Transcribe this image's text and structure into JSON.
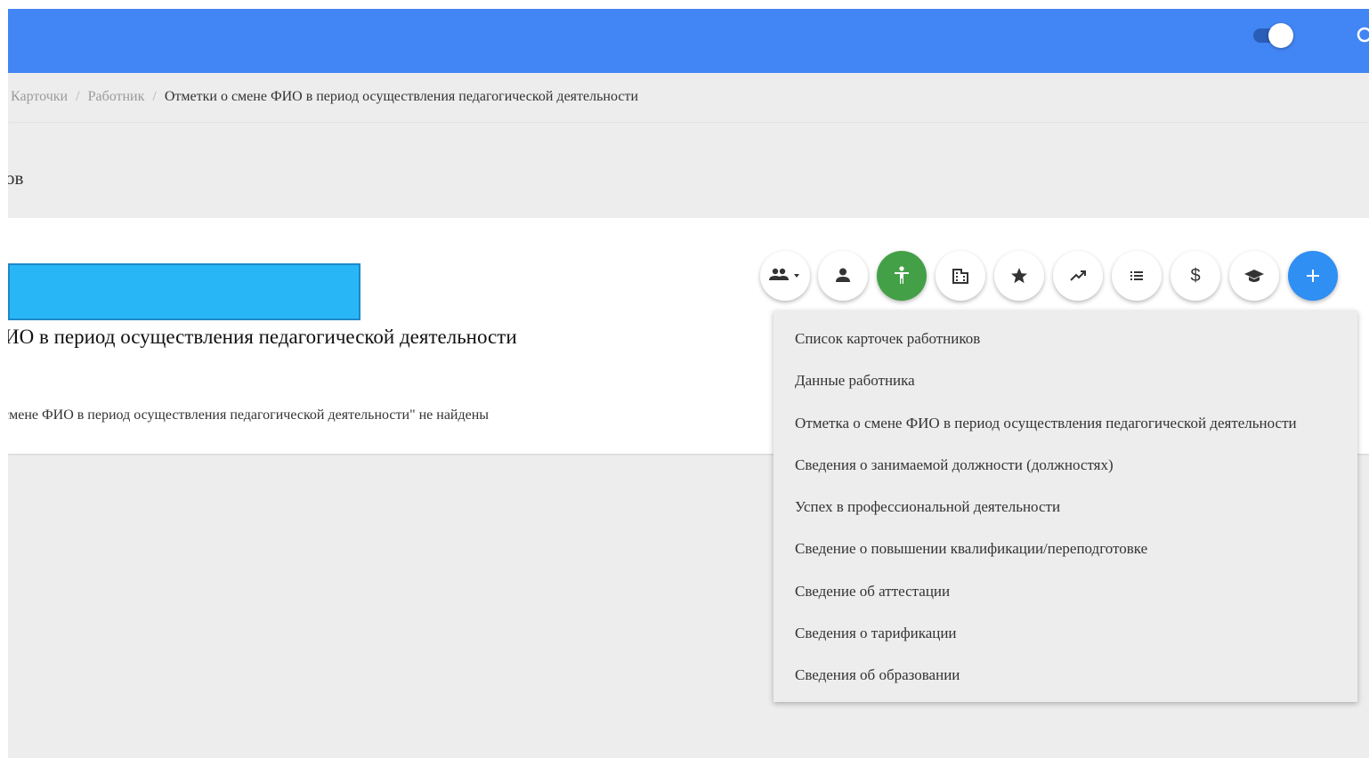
{
  "header": {
    "toggle_state": "on",
    "icons": [
      "toggle-switch",
      "search-icon"
    ],
    "bar_color": "#4285f4"
  },
  "breadcrumb": {
    "items": [
      "Карточки",
      "Работник"
    ],
    "separator": "/",
    "current": "Отметки о смене ФИО в период осуществления педагогической деятельности"
  },
  "section": {
    "title_fragment": "ов"
  },
  "card": {
    "title_fragment": "ИО в период осуществления педагогической деятельности",
    "empty_message_fragment": "смене ФИО в период осуществления педагогической деятельности\" не найдены",
    "highlight_color": "#29b6f6"
  },
  "toolbar": {
    "buttons": [
      {
        "icon": "people-dropdown-icon"
      },
      {
        "icon": "person-icon"
      },
      {
        "icon": "accessibility-icon",
        "active": true,
        "color": "#43a047"
      },
      {
        "icon": "building-icon"
      },
      {
        "icon": "star-icon"
      },
      {
        "icon": "trending-up-icon"
      },
      {
        "icon": "list-icon"
      },
      {
        "icon": "dollar-icon",
        "glyph": "$"
      },
      {
        "icon": "graduation-cap-icon"
      },
      {
        "icon": "plus-icon",
        "color": "#2f8ff3"
      }
    ]
  },
  "dropdown": {
    "items": [
      "Список карточек работников",
      "Данные работника",
      "Отметка о смене ФИО в период осуществления педагогической деятельности",
      "Сведения о занимаемой должности (должностях)",
      "Успех в профессиональной деятельности",
      "Сведение о повышении квалификации/переподготовке",
      "Сведение об аттестации",
      "Сведения о тарификации",
      "Сведения об образовании"
    ]
  }
}
